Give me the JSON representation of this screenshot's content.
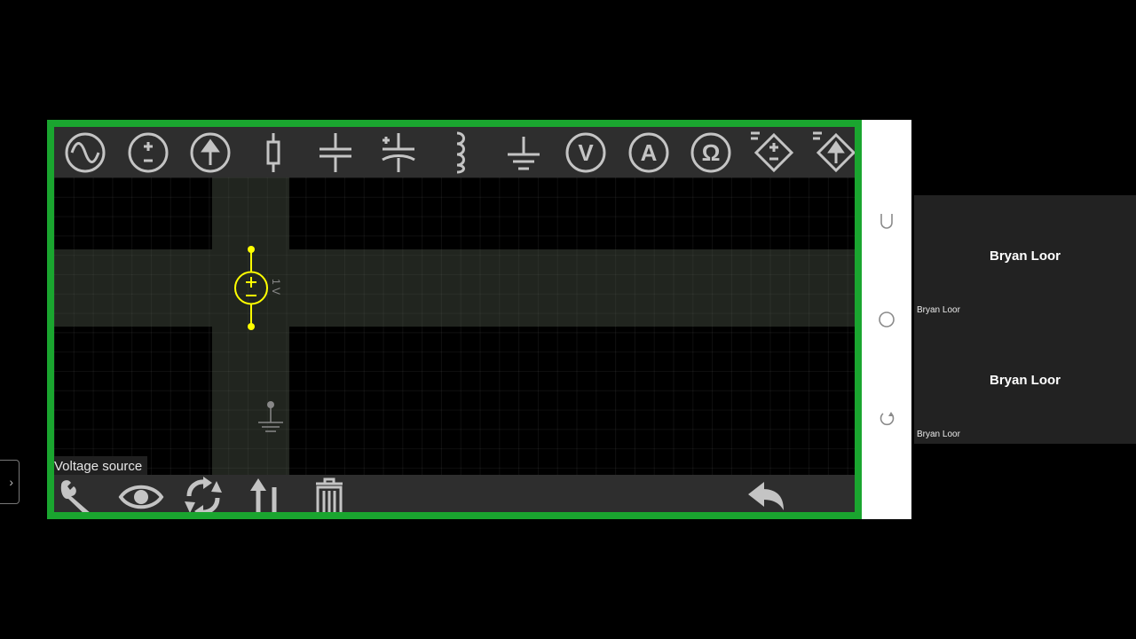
{
  "colors": {
    "frame_border": "#1aa52f",
    "toolbar_bg": "#2e2e2e",
    "icon_gray": "#c4c4c4",
    "component_yellow": "#ffff00",
    "grid_bg": "#000000",
    "nav_bar_bg": "#ffffff",
    "panel_bg": "#222222"
  },
  "top_toolbar": {
    "tools": [
      {
        "name": "ac-source",
        "icon": "sine-icon"
      },
      {
        "name": "voltage-source",
        "icon": "plus-minus-circle-icon"
      },
      {
        "name": "current-source",
        "icon": "arrow-up-circle-icon"
      },
      {
        "name": "resistor",
        "icon": "resistor-icon"
      },
      {
        "name": "capacitor",
        "icon": "capacitor-icon"
      },
      {
        "name": "polarized-capacitor",
        "icon": "polarized-capacitor-icon"
      },
      {
        "name": "inductor",
        "icon": "inductor-icon"
      },
      {
        "name": "ground",
        "icon": "ground-icon"
      },
      {
        "name": "voltmeter",
        "icon": "V",
        "letter": "V"
      },
      {
        "name": "ammeter",
        "icon": "A",
        "letter": "A"
      },
      {
        "name": "ohmmeter",
        "icon": "Ω",
        "letter": "Ω"
      },
      {
        "name": "dependent-voltage-source",
        "icon": "diamond-plus-minus-icon"
      },
      {
        "name": "dependent-current-source",
        "icon": "diamond-arrow-icon"
      }
    ]
  },
  "canvas": {
    "component_label": "1 V",
    "tooltip": "Voltage source"
  },
  "bottom_toolbar": {
    "tools": [
      {
        "name": "settings",
        "icon": "wrench-icon"
      },
      {
        "name": "view",
        "icon": "eye-icon"
      },
      {
        "name": "rotate",
        "icon": "rotate-arrows-icon"
      },
      {
        "name": "flip",
        "icon": "flip-arrow-icon"
      },
      {
        "name": "delete",
        "icon": "trash-icon"
      },
      {
        "name": "undo",
        "icon": "undo-arrow-icon"
      }
    ]
  },
  "nav_bar": {
    "buttons": [
      {
        "name": "recents",
        "icon": "recents-icon"
      },
      {
        "name": "home",
        "icon": "home-circle-icon"
      },
      {
        "name": "back",
        "icon": "back-icon"
      }
    ]
  },
  "participants": [
    {
      "name": "Bryan Loor",
      "label": "Bryan Loor"
    },
    {
      "name": "Bryan Loor",
      "label": "Bryan Loor"
    }
  ]
}
